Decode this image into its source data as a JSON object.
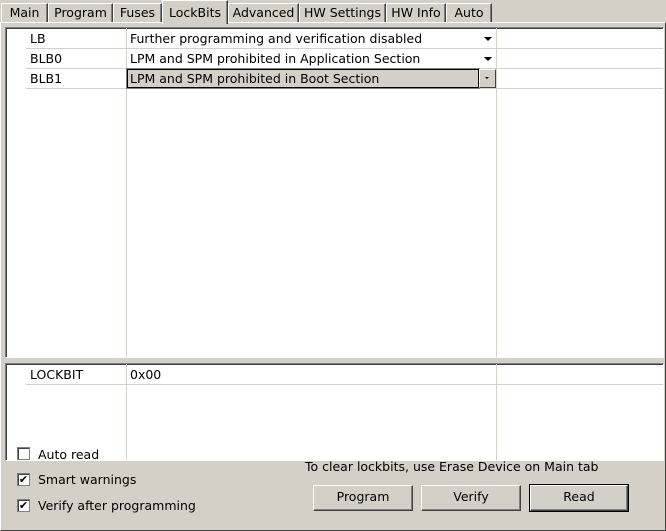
{
  "tabs": [
    {
      "label": "Main"
    },
    {
      "label": "Program"
    },
    {
      "label": "Fuses"
    },
    {
      "label": "LockBits"
    },
    {
      "label": "Advanced"
    },
    {
      "label": "HW Settings"
    },
    {
      "label": "HW Info"
    },
    {
      "label": "Auto"
    }
  ],
  "active_tab": "LockBits",
  "lockbits_table": {
    "rows": [
      {
        "name": "LB",
        "value": "Further programming and verification disabled"
      },
      {
        "name": "BLB0",
        "value": "LPM and SPM prohibited in Application Section"
      },
      {
        "name": "BLB1",
        "value": "LPM and SPM prohibited in Boot Section"
      }
    ]
  },
  "lockbyte_table": {
    "rows": [
      {
        "name": "LOCKBIT",
        "value": "0x00"
      }
    ]
  },
  "options": {
    "auto_read_label": "Auto read",
    "auto_read_checked": false,
    "smart_warnings_label": "Smart warnings",
    "smart_warnings_checked": true,
    "verify_label": "Verify after programming",
    "verify_checked": true
  },
  "hint": "To clear lockbits, use Erase Device on Main tab",
  "buttons": {
    "program": "Program",
    "verify": "Verify",
    "read": "Read"
  }
}
